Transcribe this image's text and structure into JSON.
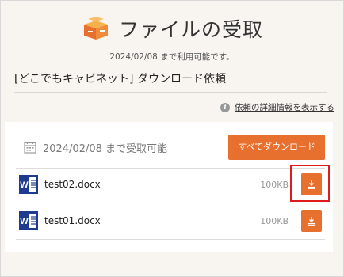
{
  "header": {
    "title": "ファイルの受取",
    "subtitle": "2024/02/08 まで利用可能です。"
  },
  "request": {
    "title": "[どこでもキャビネット] ダウンロード依頼"
  },
  "details_link": "依頼の詳細情報を表示する",
  "panel": {
    "availability": "2024/02/08 まで受取可能",
    "download_all_label": "すべてダウンロード"
  },
  "files": [
    {
      "name": "test02.docx",
      "size": "100KB"
    },
    {
      "name": "test01.docx",
      "size": "100KB"
    }
  ],
  "colors": {
    "accent": "#e8702f",
    "highlight": "#e01b1b",
    "word_blue": "#1f3b8f"
  }
}
